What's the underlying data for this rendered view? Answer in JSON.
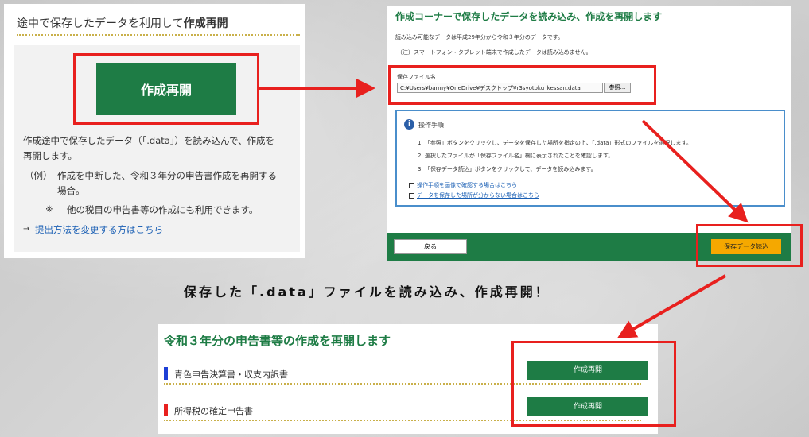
{
  "panel1": {
    "title_prefix": "途中で保存したデータを利用して",
    "title_bold": "作成再開",
    "big_button": "作成再開",
    "desc_line1": "作成途中で保存したデータ（「.data」）を読み込んで、作成を",
    "desc_line2": "再開します。",
    "example_label": "（例）",
    "example_line1": "作成を中断した、令和３年分の申告書作成を再開する",
    "example_line2": "場合。",
    "note_mark": "※",
    "note_text": "他の税目の申告書等の作成にも利用できます。",
    "link_arrow": "→",
    "link_text": "提出方法を変更する方はこちら"
  },
  "panel2": {
    "title": "作成コーナーで保存したデータを読み込み、作成を再開します",
    "line1": "読み込み可能なデータは平成29年分から令和３年分のデータです。",
    "line2": "（注）スマートフォン・タブレット端末で作成したデータは読み込めません。",
    "file_label": "保存ファイル名",
    "file_value": "C:¥Users¥barmy¥OneDrive¥デスクトップ¥r3syotoku_kessan.data",
    "browse_button": "参照...",
    "instructions_title": "操作手順",
    "info_icon_glyph": "i",
    "steps": [
      "1. 「参照」ボタンをクリックし、データを保存した場所を指定の上、「.data」形式のファイルを選択します。",
      "2. 選択したファイルが「保存ファイル名」欄に表示されたことを確認します。",
      "3. 「保存データ読込」ボタンをクリックして、データを読み込みます。"
    ],
    "link1": "操作手順を画像で確認する場合はこちら",
    "link2": "データを保存した場所が分からない場合はこちら",
    "back_button": "戻る",
    "load_button": "保存データ読込"
  },
  "headline": "保存した「.data」ファイルを読み込み、作成再開！",
  "panel3": {
    "title": "令和３年分の申告書等の作成を再開します",
    "rows": [
      {
        "label": "青色申告決算書・収支内訳書",
        "button": "作成再開",
        "bar_color": "#1d3fd6"
      },
      {
        "label": "所得税の確定申告書",
        "button": "作成再開",
        "bar_color": "#e8201e"
      }
    ]
  },
  "colors": {
    "accent_green": "#1e7c45",
    "highlight_red": "#e8201e",
    "load_orange": "#f5a800",
    "link_blue": "#1a5fb4"
  }
}
